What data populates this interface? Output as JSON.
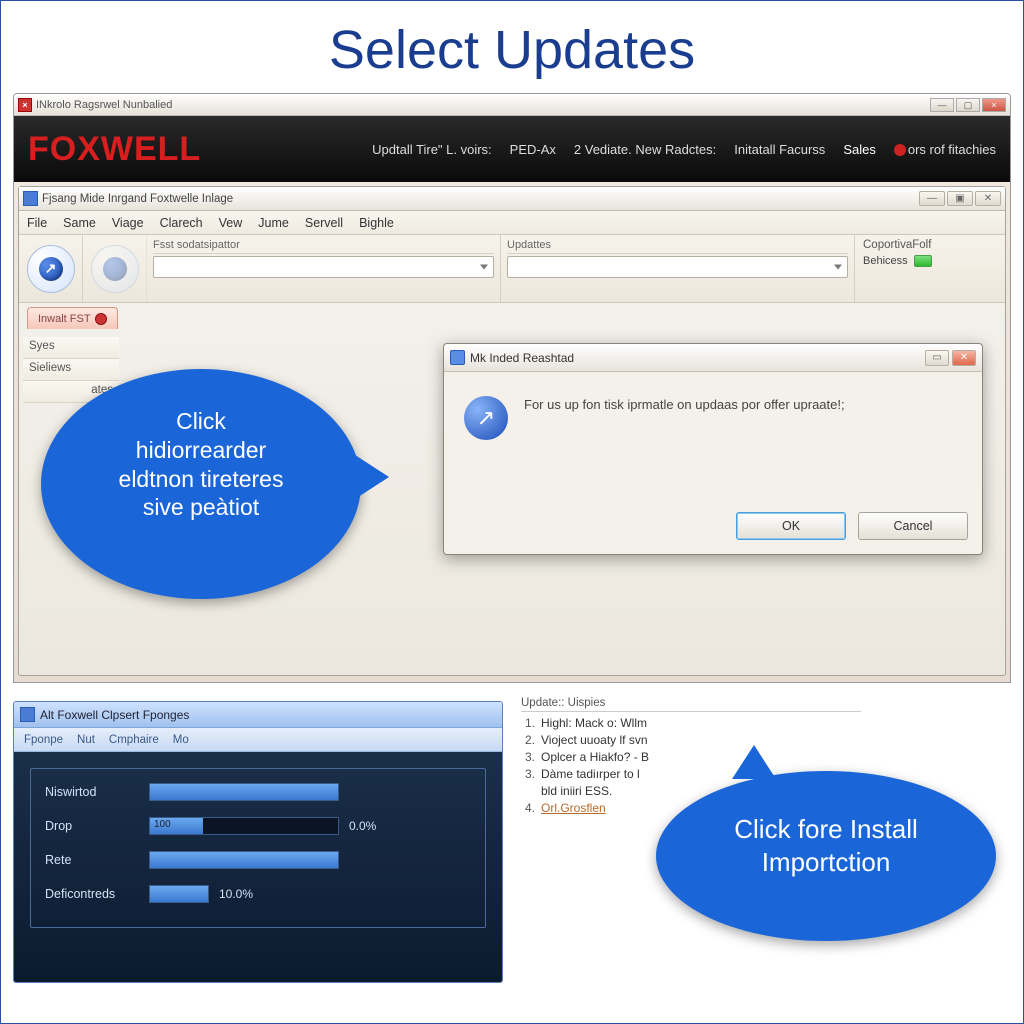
{
  "heading": "Select Updates",
  "outerWindow": {
    "title": "INkrolo Ragsrwel Nunbalied"
  },
  "brand": "FOXWELL",
  "headerLinks": {
    "a": "Updtall Tire\" L. voirs:",
    "b": "PED-Ax",
    "c": "2 Vediate. New Radctes:",
    "d": "Initatall Facurss",
    "sales": "Sales",
    "rof": "ors rof fitachies"
  },
  "innerWindow": {
    "title": "Fjsang Mide Inrgand Foxtwelle Inlage"
  },
  "menu": [
    "File",
    "Same",
    "Viage",
    "Clarech",
    "Vew",
    "Jume",
    "Servell",
    "Bighle"
  ],
  "toolbar": {
    "col1": "Fsst sodatsipattor",
    "col2": "Updattes",
    "rLabel": "CoportivaFolf",
    "rStatus": "Behicess"
  },
  "tabs": {
    "a": "Inwalt FST"
  },
  "sidebar": [
    "Syes",
    "Sieliews"
  ],
  "sidebarExtraTail": "ates",
  "dialog": {
    "title": "Mk Inded Reashtad",
    "message": "For us up fon tisk iprmatle on updaas por offer upraate!;",
    "ok": "OK",
    "cancel": "Cancel"
  },
  "callout1": {
    "line1": "Click",
    "line2": "hidiorrearder",
    "line3": "eldtnon tireteres",
    "line4": "sive peàtiot"
  },
  "callout2": {
    "line1": "Click fore Install",
    "line2": "Importction"
  },
  "progress": {
    "title": "Alt Foxwell Clpsert Fponges",
    "tabs": [
      "Fponpe",
      "Nut",
      "Cmphaire",
      "Mo"
    ],
    "rows": [
      {
        "label": "Niswirtod",
        "val": "",
        "pct": ""
      },
      {
        "label": "Drop",
        "val": "100",
        "pct": "0.0%"
      },
      {
        "label": "Rete",
        "val": "",
        "pct": ""
      },
      {
        "label": "Deficontreds",
        "val": "",
        "pct": "10.0%"
      }
    ]
  },
  "instructions": {
    "head": "Update:: Uispies",
    "items": [
      {
        "n": "1.",
        "t": "Highl: Mack o: Wllm"
      },
      {
        "n": "2.",
        "t": "Vioject uuoaty lf svn"
      },
      {
        "n": "3.",
        "t": "Oplcer a Hiakfo? - B"
      },
      {
        "n": "3.",
        "t": "Dàme tadiırper to l"
      },
      {
        "n": "",
        "t": "bld iniiri ESS."
      },
      {
        "n": "4.",
        "t": "",
        "link": "Orl.Grosflen"
      }
    ]
  }
}
